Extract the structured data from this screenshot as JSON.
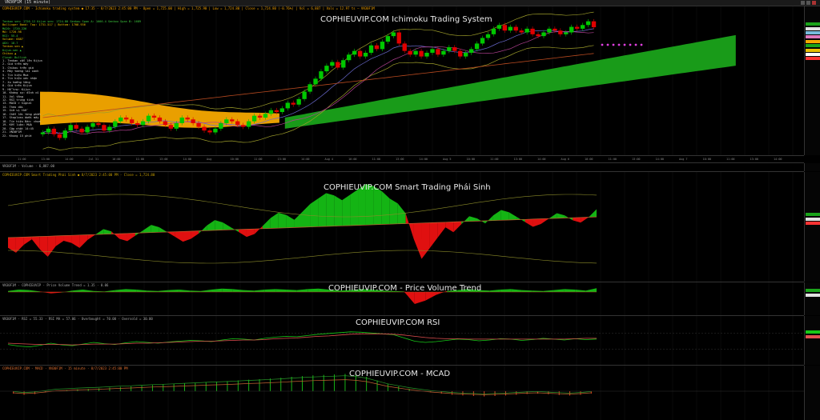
{
  "window": {
    "title": "VN30F1M (15 minute)"
  },
  "main": {
    "watermark": "COPHIEUVIP.COM Ichimoku Trading System",
    "header": "COPHIEUVIP.COM - Ichimoku trading system ● 17:35 - 8/7/2023 2:45:00 PM - Open = 1,725.00 | High = 1,725.90 | Low = 1,724.80 | Close = 1,724.80 (-0.76%) | Vol = 6,887 | Vals = 12.97 ts — VN30F1M",
    "info_lines": [
      "Tenkan sen: 1726.12  Kijun sen: 1724.80  Senkou Span A: 1666.4  Senkou Span B: 1689",
      "Bollinger Band: Top: 1731.517 | Bottom: 1708.936",
      "MA20: 1720.226",
      "MA: 1720.98",
      "RSI: 55.4",
      "Volume: 6887",
      "ADX: 18.7",
      "Tenkan-sen ▲",
      "Kijun-sen ▲",
      "Chikou ▲",
      "Cloud: Bullish",
      "1. Tenkan cắt lên Kijun",
      "2. Giá trên mây",
      "3. Chikou trên giá",
      "4. Mây tương lai xanh",
      "5. Tín hiệu Mua",
      "6. Tín hiệu xác nhận",
      "7. Xu hướng tăng",
      "8. Giá trên Kijun",
      "9. Hỗ trợ: Kijun",
      "10. Kháng cự: đỉnh cũ",
      "11. Vol tăng",
      "12. RSI trung tính",
      "13. MACD > Signal",
      "14. Theo dõi",
      "15. Giữ vị thế",
      "16. Chốt lời từng phần",
      "17. Stoploss dưới mây",
      "18. Tín hiệu Bán: chưa",
      "19. Kết luận: MUA",
      "20. Cập nhật 14:45",
      "21. VN30F1M",
      "22. Khung 15 phút"
    ]
  },
  "time_axis": [
    "11:00",
    "13:00",
    "14:00",
    "Jul 31",
    "10:00",
    "11:00",
    "13:00",
    "14:00",
    "Aug",
    "10:00",
    "11:00",
    "13:00",
    "14:00",
    "Aug 4",
    "10:00",
    "11:00",
    "13:00",
    "14:00",
    "Aug 5",
    "10:00",
    "11:00",
    "13:00",
    "14:00",
    "Aug 6",
    "10:00",
    "11:00",
    "13:00",
    "14:00",
    "Aug 7",
    "10:00",
    "11:00",
    "13:00",
    "14:00"
  ],
  "panels": {
    "volume": {
      "header": "VN30F1M · Volume · 6,887.00"
    },
    "smart": {
      "watermark": "COPHIEUVIP.COM Smart Trading Phái Sinh",
      "header": "COPHIEUVIP.COM Smart Trading Phái Sinh ● 8/7/2023 2:45:00 PM · Close = 1,724.80"
    },
    "pvt": {
      "watermark": "COPHIEUVIP.COM - Price Volume Trend",
      "header": "VN30F1M · COPHIEUVIP · Price Volume Trend = 1.35 · 0.06"
    },
    "rsi": {
      "watermark": "COPHIEUVIP.COM RSI",
      "header": "VN30F1M · RSI = 55.33 · RSI MA = 57.06 · Overbought = 70.00 · Oversold = 30.00"
    },
    "macd": {
      "watermark": "COPHIEUVIP.COM - MCAD",
      "header": "COPHIEUVIP.COM - MACD · VN30F1M · 15 minute · 8/7/2023 2:45:00 PM"
    }
  },
  "chart_data": [
    {
      "type": "candlestick",
      "title": "COPHIEUVIP.COM Ichimoku Trading System",
      "symbol": "VN30F1M",
      "interval": "15 minute",
      "ylim": [
        1660,
        1730
      ],
      "last": {
        "open": 1725.0,
        "high": 1725.9,
        "low": 1724.8,
        "close": 1724.8,
        "volume": 6887
      },
      "close_series": [
        1668,
        1670,
        1667,
        1665,
        1669,
        1672,
        1670,
        1668,
        1671,
        1673,
        1672,
        1669,
        1671,
        1674,
        1676,
        1675,
        1673,
        1672,
        1674,
        1677,
        1676,
        1674,
        1672,
        1670,
        1673,
        1676,
        1675,
        1673,
        1671,
        1669,
        1668,
        1670,
        1673,
        1675,
        1674,
        1672,
        1671,
        1674,
        1677,
        1676,
        1678,
        1680,
        1679,
        1681,
        1684,
        1683,
        1686,
        1690,
        1694,
        1697,
        1701,
        1704,
        1706,
        1703,
        1707,
        1710,
        1712,
        1709,
        1711,
        1715,
        1713,
        1717,
        1720,
        1722,
        1716,
        1712,
        1710,
        1712,
        1709,
        1711,
        1713,
        1710,
        1712,
        1714,
        1712,
        1709,
        1711,
        1713,
        1716,
        1719,
        1721,
        1724,
        1726,
        1723,
        1725,
        1723,
        1722,
        1724,
        1721,
        1720,
        1722,
        1724,
        1723,
        1721,
        1722,
        1725,
        1724,
        1726,
        1728,
        1724.8
      ],
      "colors": {
        "up": "#00c800",
        "down": "#e00000",
        "cloud_bull": "#1aa31a",
        "cloud_bear": "#f5a800"
      }
    },
    {
      "type": "area",
      "title": "COPHIEUVIP.COM Smart Trading Phái Sinh",
      "values": [
        -4,
        -6,
        -3,
        -1,
        -5,
        -8,
        -4,
        -2,
        -3,
        -5,
        -2,
        0,
        2,
        1,
        -2,
        -3,
        -1,
        1,
        3,
        2,
        0,
        -2,
        -4,
        -3,
        -1,
        2,
        4,
        3,
        1,
        -1,
        -3,
        -2,
        1,
        4,
        6,
        5,
        3,
        6,
        9,
        11,
        13,
        12,
        10,
        12,
        14,
        16,
        15,
        13,
        10,
        8,
        4,
        -6,
        -14,
        -10,
        -6,
        -2,
        -4,
        -1,
        2,
        1,
        -1,
        2,
        4,
        3,
        1,
        -1,
        -3,
        -2,
        0,
        2,
        1,
        -1,
        -2,
        0,
        3
      ],
      "colors": {
        "positive": "#14b414",
        "negative": "#e01010"
      }
    },
    {
      "type": "area",
      "title": "COPHIEUVIP.COM - Price Volume Trend",
      "values": [
        0.2,
        0.5,
        0.4,
        0.1,
        -0.3,
        -0.1,
        0.3,
        0.5,
        0.2,
        0.1,
        0.4,
        0.6,
        0.5,
        0.3,
        0.2,
        0.4,
        0.5,
        0.3,
        0.2,
        0.5,
        0.7,
        0.6,
        0.4,
        0.3,
        0.5,
        0.6,
        0.5,
        0.4,
        0.6,
        0.7,
        0.5,
        0.3,
        0.4,
        0.6,
        0.5,
        0.3,
        0.2,
        0.1,
        -2.5,
        -1.8,
        -0.6,
        0.2,
        0.4,
        0.6,
        0.4,
        0.3,
        0.5,
        0.6,
        0.4,
        0.3,
        0.2,
        0.4,
        0.6,
        0.5,
        0.3,
        0.8
      ],
      "colors": {
        "positive": "#14b414",
        "negative": "#e01010"
      }
    },
    {
      "type": "line",
      "title": "COPHIEUVIP.COM RSI",
      "ylim": [
        0,
        100
      ],
      "series": [
        {
          "name": "RSI",
          "color": "#18c818",
          "values": [
            42,
            38,
            36,
            40,
            45,
            41,
            39,
            43,
            47,
            44,
            42,
            46,
            49,
            47,
            45,
            48,
            50,
            52,
            51,
            49,
            53,
            56,
            55,
            53,
            57,
            60,
            62,
            61,
            64,
            67,
            69,
            71,
            73,
            72,
            70,
            68,
            66,
            58,
            50,
            47,
            49,
            52,
            55,
            54,
            51,
            53,
            56,
            55,
            52,
            54,
            57,
            55,
            53,
            56,
            54,
            55.3
          ]
        },
        {
          "name": "RSI MA",
          "color": "#e05050",
          "values": [
            45,
            44,
            43,
            42,
            42,
            42,
            41,
            42,
            43,
            43,
            43,
            44,
            45,
            45,
            46,
            47,
            48,
            49,
            50,
            50,
            51,
            52,
            53,
            53,
            54,
            56,
            57,
            58,
            60,
            62,
            63,
            65,
            67,
            68,
            68,
            68,
            67,
            65,
            62,
            59,
            57,
            56,
            56,
            55,
            55,
            55,
            55,
            55,
            55,
            55,
            55,
            55,
            55,
            56,
            57,
            57.1
          ]
        }
      ]
    },
    {
      "type": "bar",
      "title": "COPHIEUVIP.COM - MCAD",
      "values": [
        -1,
        -1.5,
        -1.2,
        -0.5,
        0.2,
        0.5,
        0.8,
        1.0,
        1.2,
        1.5,
        1.8,
        2.0,
        2.3,
        2.6,
        2.8,
        3.0,
        3.3,
        3.5,
        3.8,
        4.0,
        4.2,
        4.5,
        4.8,
        5.0,
        5.3,
        5.6,
        6.0,
        6.3,
        6.6,
        6.8,
        7.0,
        7.2,
        6.8,
        6.0,
        4.5,
        3.0,
        2.0,
        1.0,
        0.2,
        -0.5,
        -1.0,
        -1.5,
        -1.8,
        -2.0,
        -2.2,
        -2.0,
        -1.8,
        -1.5,
        -1.2,
        -1.0,
        -1.3,
        -1.6,
        -1.8,
        -1.5,
        -1.0
      ],
      "colors": {
        "positive": "#18c818",
        "negative": "#ff5020"
      }
    }
  ]
}
